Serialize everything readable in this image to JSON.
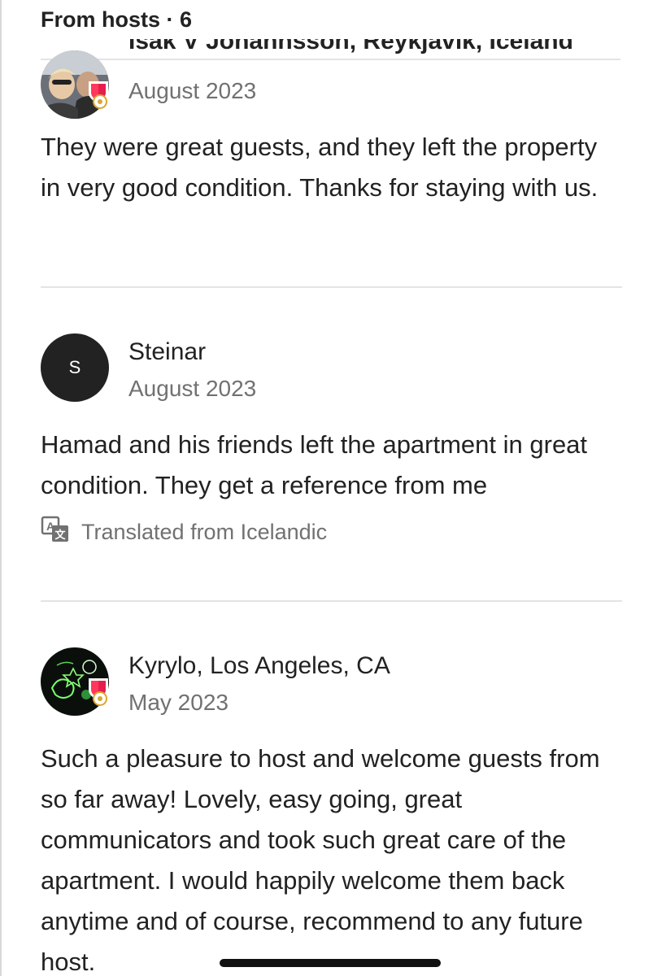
{
  "header": {
    "title": "From hosts · 6"
  },
  "reviews": [
    {
      "name": "Ísak V Jóhannsson, Reykjavík, Iceland",
      "date": "August 2023",
      "body": "They were  great guests, and they left the property in very good condition. Thanks for staying with us.",
      "avatar": "photo",
      "badge": "superhost-icon"
    },
    {
      "name": "Steinar",
      "initial": "S",
      "date": "August 2023",
      "body": "Hamad and his friends left the apartment in great condition. They get a reference from me",
      "translated": "Translated from Icelandic",
      "avatar": "initial"
    },
    {
      "name": "Kyrylo, Los Angeles, CA",
      "date": "May 2023",
      "body": "Such a pleasure to host and welcome guests from so far away! Lovely, easy going, great communicators and took such great care of the apartment. I would happily welcome them back anytime and of course, recommend to any future host.",
      "avatar": "photo",
      "badge": "superhost-icon"
    }
  ],
  "colors": {
    "text": "#222222",
    "secondary": "#717171",
    "divider": "#e4e4e4",
    "badge_red": "#ff385c",
    "badge_gold": "#d9a72f"
  }
}
